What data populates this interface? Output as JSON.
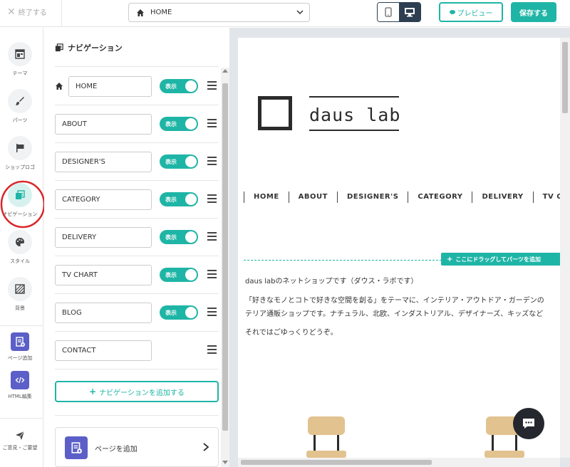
{
  "topbar": {
    "close_label": "終了する",
    "page_select_value": "HOME",
    "preview_label": "プレビュー",
    "save_label": "保存する"
  },
  "sidebar": {
    "items": [
      {
        "label": "テーマ",
        "icon": "theme-icon"
      },
      {
        "label": "パーツ",
        "icon": "brush-icon"
      },
      {
        "label": "ショップロゴ",
        "icon": "flag-icon"
      },
      {
        "label": "ナビゲーション",
        "icon": "navigation-icon",
        "active": true
      },
      {
        "label": "スタイル",
        "icon": "palette-icon"
      },
      {
        "label": "背景",
        "icon": "background-icon"
      },
      {
        "label": "ページ追加",
        "icon": "add-page-icon"
      },
      {
        "label": "HTML編集",
        "icon": "code-icon"
      },
      {
        "label": "ご意見・ご要望",
        "icon": "paper-plane-icon"
      }
    ]
  },
  "nav_panel": {
    "title": "ナビゲーション",
    "toggle_label": "表示",
    "items": [
      {
        "label": "HOME",
        "visible": true,
        "home": true
      },
      {
        "label": "ABOUT",
        "visible": true
      },
      {
        "label": "DESIGNER'S",
        "visible": true
      },
      {
        "label": "CATEGORY",
        "visible": true
      },
      {
        "label": "DELIVERY",
        "visible": true
      },
      {
        "label": "TV CHART",
        "visible": true
      },
      {
        "label": "BLOG",
        "visible": true
      },
      {
        "label": "CONTACT",
        "visible": false
      }
    ],
    "add_nav_label": "ナビゲーションを追加する",
    "add_page_label": "ページを追加"
  },
  "preview": {
    "logo_text": "daus lab",
    "global_nav": [
      "HOME",
      "ABOUT",
      "DESIGNER'S",
      "CATEGORY",
      "DELIVERY",
      "TV CHART"
    ],
    "drop_badge": "ここにドラッグしてパーツを追加",
    "paragraphs": [
      "daus labのネットショップです（ダウス・ラボです）",
      "「好きなモノとコトで好きな空間を創る」をテーマに、インテリア・アウトドア・ガーデンの",
      "テリア通販ショップです。ナチュラル、北欧、インダストリアル、デザイナーズ、キッズなど",
      "それではごゆっくりどうぞ。"
    ]
  },
  "colors": {
    "accent": "#1fb5a6",
    "dark": "#2c3e50",
    "purple": "#5b5fc7",
    "highlight_circle": "#d9262b"
  }
}
